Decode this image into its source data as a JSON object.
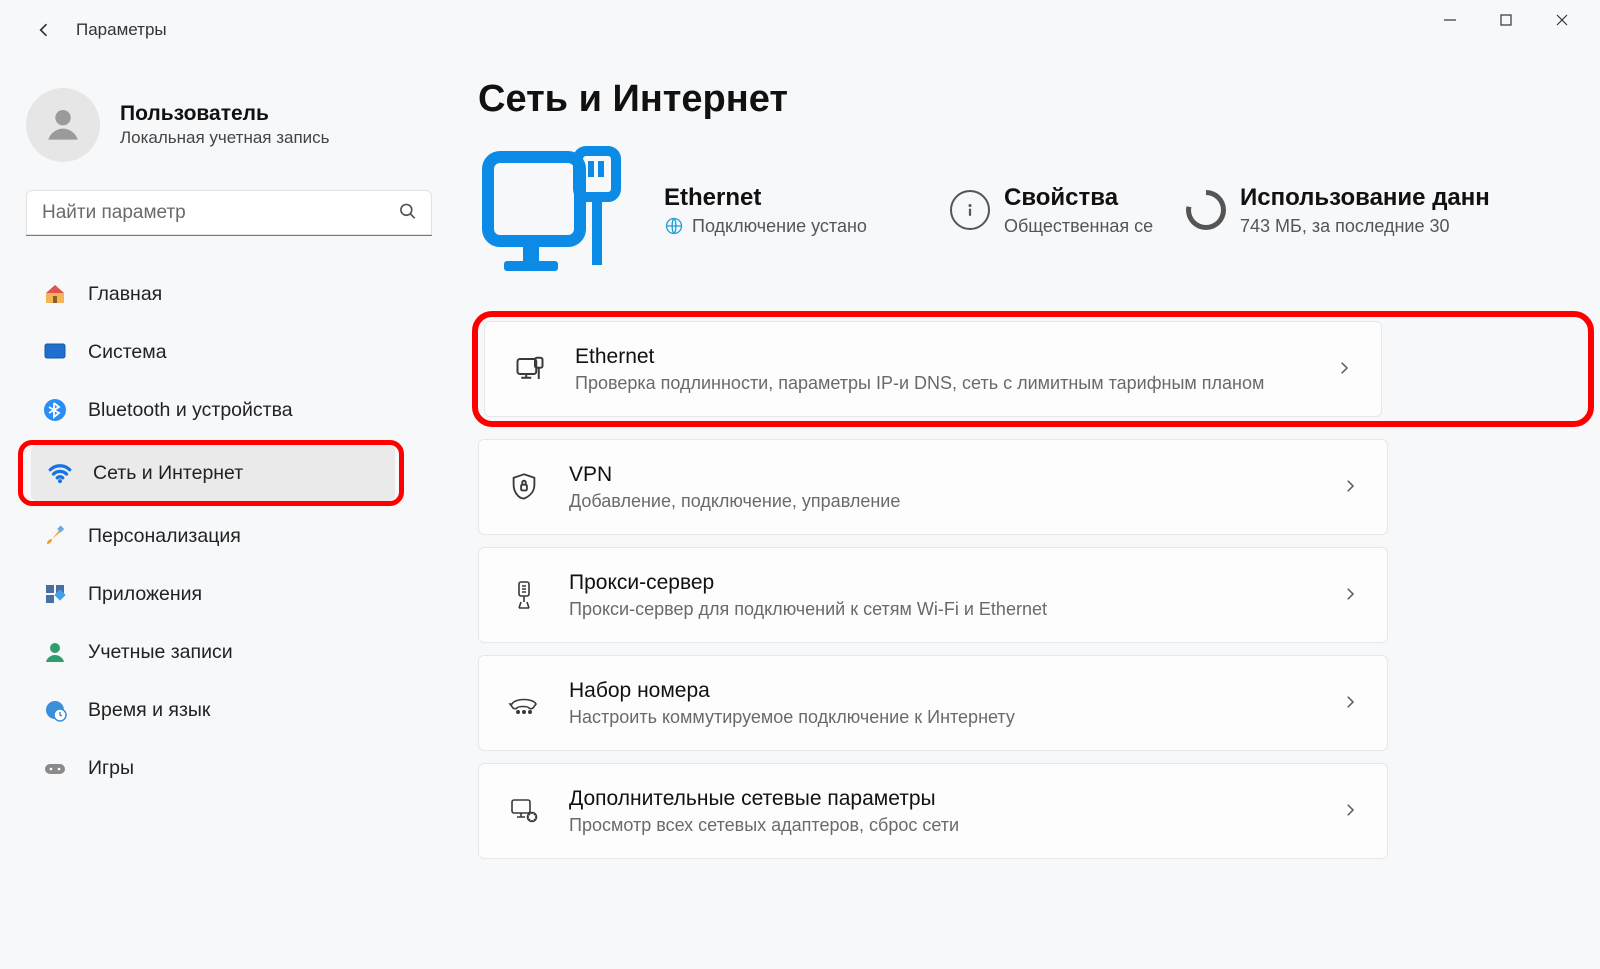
{
  "titlebar": {
    "title": "Параметры"
  },
  "user": {
    "name": "Пользователь",
    "subtitle": "Локальная учетная запись"
  },
  "search": {
    "placeholder": "Найти параметр"
  },
  "sidebar": {
    "items": [
      {
        "label": "Главная"
      },
      {
        "label": "Система"
      },
      {
        "label": "Bluetooth и устройства"
      },
      {
        "label": "Сеть и Интернет"
      },
      {
        "label": "Персонализация"
      },
      {
        "label": "Приложения"
      },
      {
        "label": "Учетные записи"
      },
      {
        "label": "Время и язык"
      },
      {
        "label": "Игры"
      }
    ]
  },
  "page": {
    "title": "Сеть и Интернет",
    "status": {
      "ethernet": {
        "title": "Ethernet",
        "subtitle": "Подключение устано"
      },
      "properties": {
        "title": "Свойства",
        "subtitle": "Общественная се"
      },
      "usage": {
        "title": "Использование данн",
        "subtitle": "743 МБ, за последние 30"
      }
    },
    "cards": [
      {
        "title": "Ethernet",
        "subtitle": "Проверка подлинности, параметры IP-и DNS, сеть с лимитным тарифным планом"
      },
      {
        "title": "VPN",
        "subtitle": "Добавление, подключение, управление"
      },
      {
        "title": "Прокси-сервер",
        "subtitle": "Прокси-сервер для подключений к сетям Wi-Fi и Ethernet"
      },
      {
        "title": "Набор номера",
        "subtitle": "Настроить коммутируемое подключение к Интернету"
      },
      {
        "title": "Дополнительные сетевые параметры",
        "subtitle": "Просмотр всех сетевых адаптеров, сброс сети"
      }
    ]
  }
}
